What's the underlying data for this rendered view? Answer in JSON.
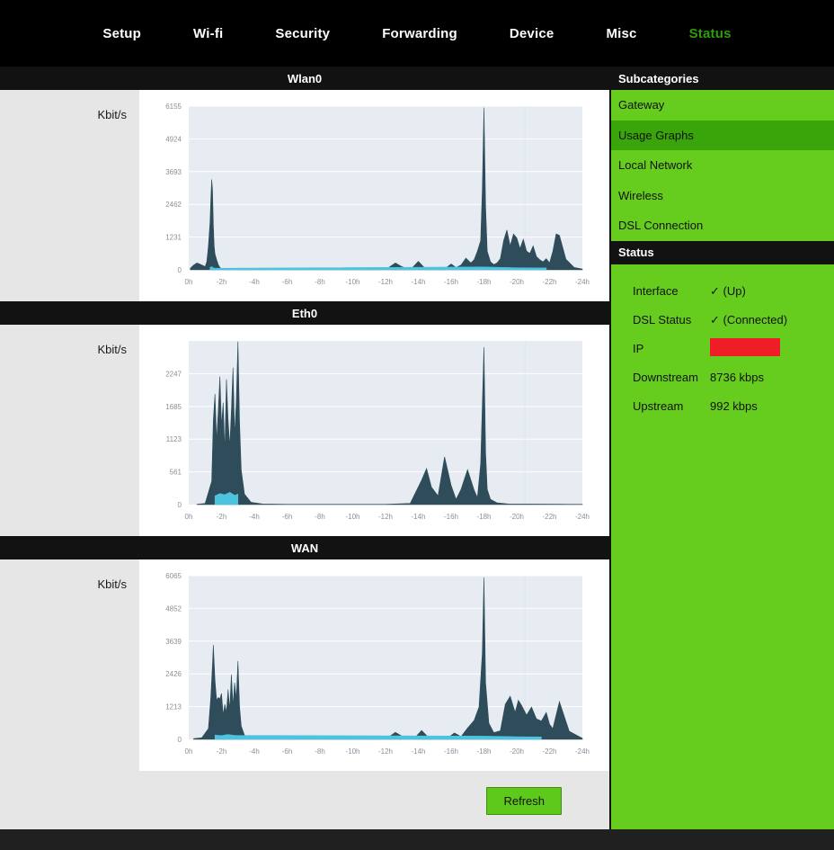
{
  "nav": {
    "items": [
      {
        "label": "Setup",
        "active": false
      },
      {
        "label": "Wi-fi",
        "active": false
      },
      {
        "label": "Security",
        "active": false
      },
      {
        "label": "Forwarding",
        "active": false
      },
      {
        "label": "Device",
        "active": false
      },
      {
        "label": "Misc",
        "active": false
      },
      {
        "label": "Status",
        "active": true
      }
    ]
  },
  "graphs": [
    {
      "title": "Wlan0",
      "unit": "Kbit/s"
    },
    {
      "title": "Eth0",
      "unit": "Kbit/s"
    },
    {
      "title": "WAN",
      "unit": "Kbit/s"
    }
  ],
  "actions": {
    "refresh_label": "Refresh"
  },
  "sidebar": {
    "subcategories_header": "Subcategories",
    "items": [
      {
        "label": "Gateway",
        "active": false
      },
      {
        "label": "Usage Graphs",
        "active": true
      },
      {
        "label": "Local Network",
        "active": false
      },
      {
        "label": "Wireless",
        "active": false
      },
      {
        "label": "DSL Connection",
        "active": false
      }
    ],
    "status_header": "Status",
    "status_rows": [
      {
        "key": "Interface",
        "value": "✓ (Up)",
        "redacted": false
      },
      {
        "key": "DSL Status",
        "value": "✓ (Connected)",
        "redacted": false
      },
      {
        "key": "IP",
        "value": "",
        "redacted": true
      },
      {
        "key": "Downstream",
        "value": "8736 kbps",
        "redacted": false
      },
      {
        "key": "Upstream",
        "value": "992 kbps",
        "redacted": false
      }
    ]
  },
  "colors": {
    "nav_bg": "#000000",
    "nav_text": "#ffffff",
    "nav_active_text": "#2d9e0a",
    "sidebar_green": "#66cc1e",
    "sidebar_active_green": "#3aa50a",
    "header_bar": "#121212",
    "page_gray": "#e6e6e6",
    "plot_bg": "#e6ecf2",
    "plot_series": "#2e4c5a",
    "plot_series_secondary": "#4ec3e0",
    "redacted_red": "#ef1d26",
    "refresh_button": "#5ec91b"
  },
  "chart_data": [
    {
      "type": "area",
      "title": "Wlan0",
      "ylabel": "Kbit/s",
      "xlabel": "",
      "ylim": [
        0,
        6155
      ],
      "yticks": [
        0,
        1231,
        2462,
        3693,
        4924,
        6155
      ],
      "xticks": [
        "0h",
        "-2h",
        "-4h",
        "-6h",
        "-8h",
        "-10h",
        "-12h",
        "-14h",
        "-16h",
        "-18h",
        "-20h",
        "-22h",
        "-24h"
      ],
      "xlim_hours": [
        0,
        -24
      ],
      "grid": "horizontal",
      "legend": "none",
      "series": [
        {
          "name": "traffic",
          "color": "#2e4c5a",
          "x_hours": [
            -0.1,
            -0.3,
            -0.5,
            -0.7,
            -0.9,
            -1.0,
            -1.1,
            -1.2,
            -1.3,
            -1.35,
            -1.4,
            -1.45,
            -1.5,
            -1.55,
            -1.6,
            -1.7,
            -1.8,
            -1.9,
            -2.0,
            -2.2,
            -2.6,
            -3.2,
            -4.0,
            -5.0,
            -6.0,
            -7.0,
            -8.0,
            -9.0,
            -10.0,
            -11.0,
            -12.0,
            -12.6,
            -13.0,
            -13.3,
            -13.6,
            -14.0,
            -14.4,
            -14.8,
            -15.2,
            -15.6,
            -16.0,
            -16.3,
            -16.6,
            -16.9,
            -17.2,
            -17.4,
            -17.6,
            -17.8,
            -17.9,
            -18.0,
            -18.1,
            -18.2,
            -18.4,
            -18.6,
            -18.8,
            -19.0,
            -19.2,
            -19.4,
            -19.6,
            -19.8,
            -20.0,
            -20.2,
            -20.4,
            -20.6,
            -20.8,
            -21.0,
            -21.2,
            -21.4,
            -21.6,
            -21.8,
            -22.0,
            -22.2,
            -22.4,
            -22.6,
            -23.0,
            -23.5,
            -24.0
          ],
          "y_values": [
            60,
            180,
            260,
            210,
            150,
            120,
            300,
            900,
            1800,
            2700,
            3400,
            3000,
            1700,
            900,
            600,
            380,
            200,
            90,
            40,
            20,
            10,
            8,
            6,
            5,
            5,
            5,
            5,
            5,
            6,
            8,
            10,
            260,
            120,
            40,
            60,
            320,
            60,
            30,
            25,
            40,
            220,
            90,
            180,
            440,
            260,
            380,
            700,
            1100,
            3000,
            6100,
            2400,
            700,
            300,
            200,
            260,
            420,
            1100,
            1500,
            900,
            1350,
            1200,
            800,
            1150,
            700,
            620,
            900,
            500,
            380,
            300,
            420,
            260,
            700,
            1350,
            1300,
            400,
            90,
            30
          ]
        },
        {
          "name": "traffic-secondary",
          "color": "#4ec3e0",
          "x_hours": [
            -1.3,
            -1.4,
            -1.5,
            -1.6,
            -18.0,
            -20.0,
            -21.8
          ],
          "y_values": [
            90,
            120,
            80,
            60,
            110,
            80,
            70
          ]
        }
      ]
    },
    {
      "type": "area",
      "title": "Eth0",
      "ylabel": "Kbit/s",
      "xlabel": "",
      "ylim": [
        0,
        2809
      ],
      "yticks": [
        0,
        561,
        1123,
        1685,
        2247
      ],
      "xticks": [
        "0h",
        "-2h",
        "-4h",
        "-6h",
        "-8h",
        "-10h",
        "-12h",
        "-14h",
        "-16h",
        "-18h",
        "-20h",
        "-22h",
        "-24h"
      ],
      "xlim_hours": [
        0,
        -24
      ],
      "grid": "horizontal",
      "legend": "none",
      "series": [
        {
          "name": "traffic",
          "color": "#2e4c5a",
          "x_hours": [
            -0.5,
            -1.0,
            -1.4,
            -1.5,
            -1.6,
            -1.7,
            -1.8,
            -1.9,
            -2.0,
            -2.1,
            -2.2,
            -2.3,
            -2.4,
            -2.5,
            -2.6,
            -2.7,
            -2.8,
            -2.9,
            -3.0,
            -3.1,
            -3.2,
            -3.4,
            -3.8,
            -4.5,
            -6.0,
            -8.0,
            -10.0,
            -12.0,
            -13.5,
            -14.2,
            -14.5,
            -14.8,
            -15.2,
            -15.6,
            -16.0,
            -16.3,
            -16.6,
            -17.0,
            -17.4,
            -17.6,
            -17.8,
            -18.0,
            -18.1,
            -18.2,
            -18.4,
            -18.8,
            -19.5,
            -21.0,
            -22.5,
            -24.0
          ],
          "y_values": [
            5,
            20,
            400,
            1450,
            1900,
            1100,
            1600,
            2200,
            1350,
            1750,
            900,
            2150,
            1450,
            1000,
            1600,
            2350,
            1200,
            1750,
            2800,
            1400,
            600,
            180,
            40,
            10,
            5,
            5,
            5,
            5,
            20,
            420,
            620,
            300,
            150,
            820,
            330,
            90,
            260,
            600,
            250,
            120,
            700,
            2700,
            900,
            260,
            90,
            30,
            10,
            8,
            6,
            5
          ]
        },
        {
          "name": "traffic-secondary",
          "color": "#4ec3e0",
          "x_hours": [
            -1.6,
            -1.9,
            -2.2,
            -2.5,
            -2.8,
            -3.0
          ],
          "y_values": [
            150,
            190,
            170,
            210,
            160,
            180
          ]
        }
      ]
    },
    {
      "type": "area",
      "title": "WAN",
      "ylabel": "Kbit/s",
      "xlabel": "",
      "ylim": [
        0,
        6065
      ],
      "yticks": [
        0,
        1213,
        2426,
        3639,
        4852,
        6065
      ],
      "xticks": [
        "0h",
        "-2h",
        "-4h",
        "-6h",
        "-8h",
        "-10h",
        "-12h",
        "-14h",
        "-16h",
        "-18h",
        "-20h",
        "-22h",
        "-24h"
      ],
      "xlim_hours": [
        0,
        -24
      ],
      "grid": "horizontal",
      "legend": "none",
      "series": [
        {
          "name": "traffic",
          "color": "#2e4c5a",
          "x_hours": [
            -0.3,
            -0.8,
            -1.2,
            -1.35,
            -1.45,
            -1.5,
            -1.6,
            -1.7,
            -1.8,
            -1.9,
            -2.0,
            -2.1,
            -2.2,
            -2.3,
            -2.4,
            -2.5,
            -2.6,
            -2.7,
            -2.8,
            -2.9,
            -3.0,
            -3.1,
            -3.2,
            -3.4,
            -3.8,
            -4.5,
            -6.0,
            -8.0,
            -10.0,
            -12.0,
            -12.6,
            -13.0,
            -13.4,
            -13.8,
            -14.2,
            -14.6,
            -15.0,
            -15.4,
            -15.8,
            -16.2,
            -16.6,
            -17.0,
            -17.4,
            -17.7,
            -17.9,
            -18.0,
            -18.1,
            -18.3,
            -18.6,
            -19.0,
            -19.3,
            -19.6,
            -19.9,
            -20.1,
            -20.3,
            -20.6,
            -20.9,
            -21.2,
            -21.5,
            -21.8,
            -22.0,
            -22.2,
            -22.6,
            -23.2,
            -24.0
          ],
          "y_values": [
            30,
            60,
            400,
            1600,
            2800,
            3500,
            2200,
            1450,
            1550,
            1500,
            1700,
            900,
            1300,
            1000,
            1850,
            1100,
            2400,
            1250,
            2100,
            1500,
            2900,
            1200,
            500,
            150,
            40,
            10,
            6,
            5,
            5,
            8,
            260,
            120,
            50,
            70,
            330,
            80,
            40,
            30,
            60,
            240,
            100,
            420,
            700,
            1200,
            3200,
            6000,
            2100,
            600,
            250,
            320,
            1300,
            1600,
            1000,
            1450,
            1250,
            900,
            1200,
            760,
            680,
            1000,
            560,
            400,
            1400,
            300,
            40
          ]
        },
        {
          "name": "traffic-secondary",
          "color": "#4ec3e0",
          "x_hours": [
            -1.6,
            -2.0,
            -2.4,
            -2.8,
            -18.0,
            -20.0,
            -21.5
          ],
          "y_values": [
            160,
            140,
            180,
            150,
            120,
            100,
            90
          ]
        }
      ]
    }
  ]
}
